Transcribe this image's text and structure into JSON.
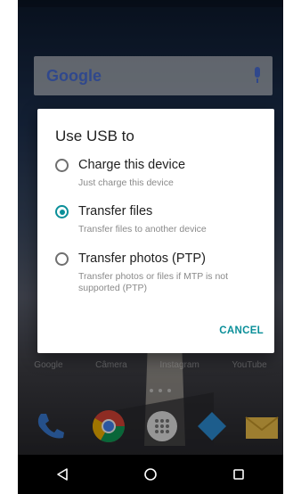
{
  "home": {
    "search_logo": "Google",
    "app_labels": [
      "Google",
      "Câmera",
      "Instagram",
      "YouTube"
    ]
  },
  "dialog": {
    "title": "Use USB to",
    "options": [
      {
        "label": "Charge this device",
        "description": "Just charge this device",
        "selected": false
      },
      {
        "label": "Transfer files",
        "description": "Transfer files to another device",
        "selected": true
      },
      {
        "label": "Transfer photos (PTP)",
        "description": "Transfer photos or files if MTP is not supported (PTP)",
        "selected": false
      }
    ],
    "cancel_label": "CANCEL"
  },
  "colors": {
    "accent": "#0a8f99",
    "dim_overlay": "rgba(0,0,0,0.35)"
  },
  "icons": {
    "search_bar": [
      "google-logo",
      "mic-icon"
    ],
    "dock": [
      "phone-icon",
      "chrome-icon",
      "app-drawer-icon",
      "messages-icon",
      "email-icon"
    ],
    "navbar": [
      "back-icon",
      "home-icon",
      "recents-icon"
    ]
  }
}
